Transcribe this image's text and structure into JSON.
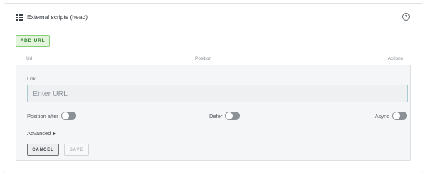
{
  "header": {
    "icon": "list-icon",
    "title": "External scripts (head)",
    "help_icon": "help-icon",
    "help_glyph": "?"
  },
  "toolbar": {
    "add_url_label": "ADD URL"
  },
  "columns": {
    "url": "Url",
    "position": "Position",
    "actions": "Actions"
  },
  "form": {
    "link_label": "Link",
    "url_value": "",
    "url_placeholder": "Enter URL",
    "toggles": [
      {
        "label": "Position after",
        "on": false
      },
      {
        "label": "Defer",
        "on": false
      },
      {
        "label": "Async",
        "on": false
      }
    ],
    "advanced_label": "Advanced",
    "cancel_label": "CANCEL",
    "save_label": "SAVE"
  },
  "colors": {
    "accent_green": "#87cc78",
    "accent_green_bg": "#e3f4dc",
    "toggle_off": "#8b9197",
    "input_border": "#a9c9d0"
  }
}
